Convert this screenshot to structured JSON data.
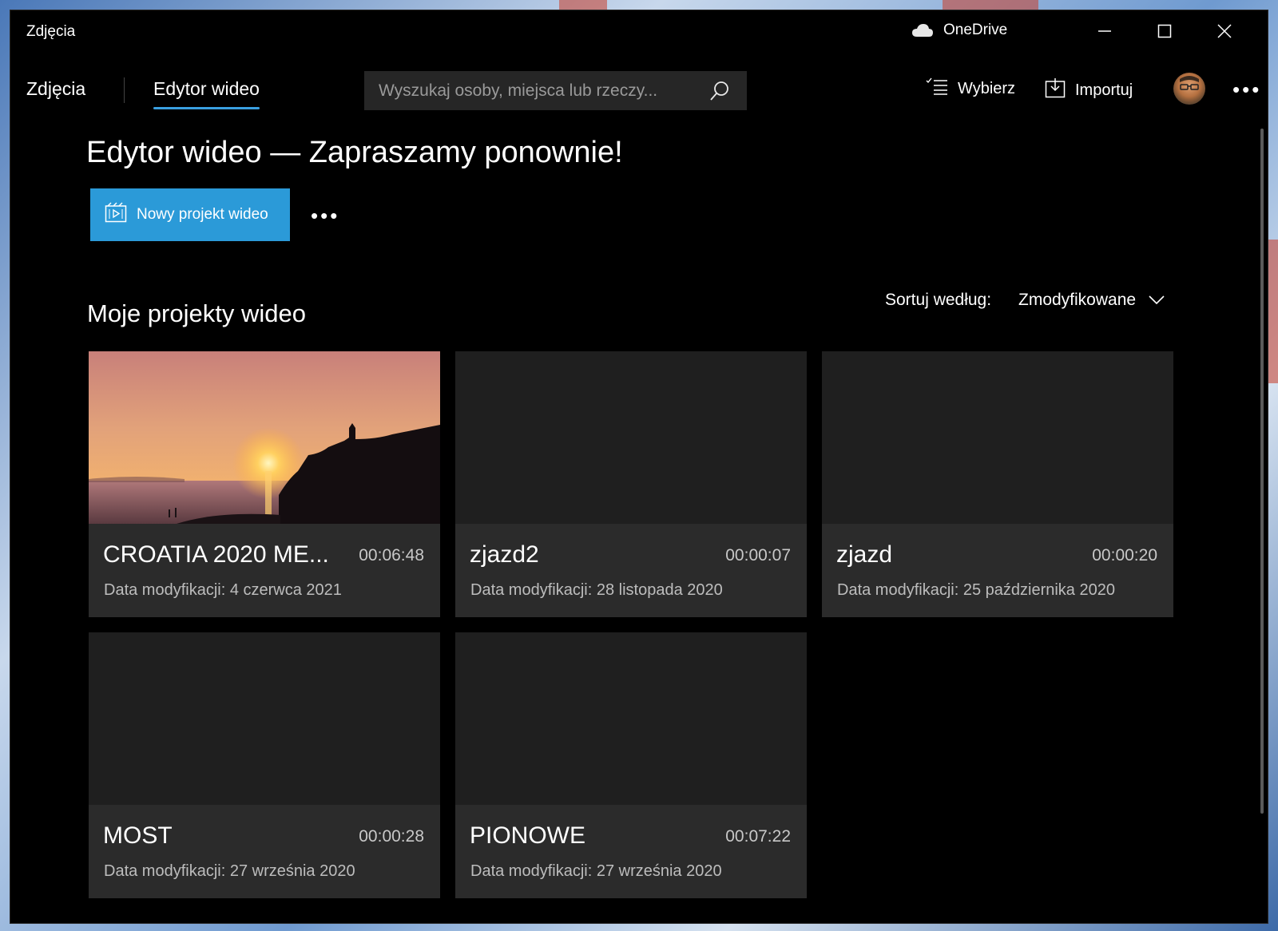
{
  "window": {
    "title": "Zdjęcia",
    "onedrive_label": "OneDrive"
  },
  "nav": {
    "tabs": [
      {
        "label": "Zdjęcia",
        "active": false
      },
      {
        "label": "Edytor wideo",
        "active": true
      }
    ],
    "accent_color": "#3a9fe0"
  },
  "search": {
    "placeholder": "Wyszukaj osoby, miejsca lub rzeczy..."
  },
  "toolbar": {
    "select_label": "Wybierz",
    "import_label": "Importuj"
  },
  "main": {
    "title": "Edytor wideo — Zapraszamy ponownie!",
    "new_project_label": "Nowy projekt wideo",
    "new_project_color": "#2b9ad8",
    "section_title": "Moje projekty wideo",
    "sort_label": "Sortuj według:",
    "sort_value": "Zmodyfikowane"
  },
  "projects": [
    {
      "name": "CROATIA 2020 ME...",
      "duration": "00:06:48",
      "modified": "Data modyfikacji: 4 czerwca 2021",
      "has_thumbnail": true
    },
    {
      "name": "zjazd2",
      "duration": "00:00:07",
      "modified": "Data modyfikacji: 28 listopada 2020",
      "has_thumbnail": false
    },
    {
      "name": "zjazd",
      "duration": "00:00:20",
      "modified": "Data modyfikacji: 25 października 2020",
      "has_thumbnail": false
    },
    {
      "name": "MOST",
      "duration": "00:00:28",
      "modified": "Data modyfikacji: 27 września 2020",
      "has_thumbnail": false
    },
    {
      "name": "PIONOWE",
      "duration": "00:07:22",
      "modified": "Data modyfikacji: 27 września 2020",
      "has_thumbnail": false
    }
  ]
}
